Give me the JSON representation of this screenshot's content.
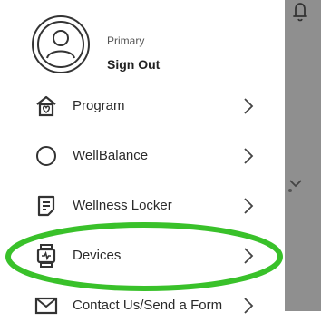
{
  "profile": {
    "role": "Primary",
    "sign_out_label": "Sign Out"
  },
  "menu": {
    "items": [
      {
        "label": "Program",
        "icon": "home-heart-icon"
      },
      {
        "label": "WellBalance",
        "icon": "circle-icon"
      },
      {
        "label": "Wellness Locker",
        "icon": "document-icon"
      },
      {
        "label": "Devices",
        "icon": "watch-icon"
      },
      {
        "label": "Contact Us/Send a Form",
        "icon": "mail-icon"
      }
    ]
  },
  "colors": {
    "highlight": "#39c12a",
    "icon": "#333333",
    "backdrop": "#8f8f8f"
  }
}
